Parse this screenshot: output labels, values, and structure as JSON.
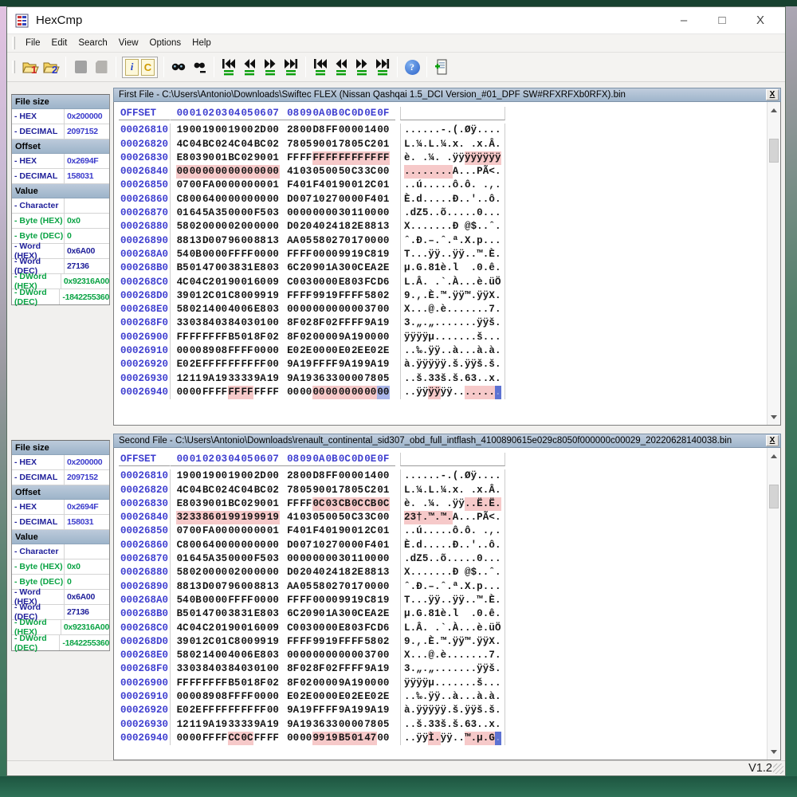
{
  "window": {
    "title": "HexCmp",
    "controls": {
      "minimize": "–",
      "maximize": "□",
      "close": "X"
    }
  },
  "menu": {
    "items": [
      "File",
      "Edit",
      "Search",
      "View",
      "Options",
      "Help"
    ]
  },
  "toolbar": {
    "open_first_label": "1",
    "open_second_label": "2",
    "info_label": "i",
    "compare_label": "C",
    "help_label": "?"
  },
  "status": {
    "version": "V1.2"
  },
  "hex_table": {
    "offset_label": "OFFSET",
    "columns": [
      "00",
      "01",
      "02",
      "03",
      "04",
      "05",
      "06",
      "07",
      "08",
      "09",
      "0A",
      "0B",
      "0C",
      "0D",
      "0E",
      "0F"
    ]
  },
  "colors": {
    "diff_highlight": "#f6c9c9",
    "selection_highlight": "#a9b5e9",
    "cursor_block": "#5d72d2",
    "offset_text": "#3f3fd0",
    "value_green": "#0aa344",
    "value_navy": "#20209a",
    "value_blue": "#3c3ccc",
    "pane_header_bg": "#a9bed4"
  },
  "inspector": {
    "sections": [
      {
        "header": "File size",
        "rows": [
          {
            "label": "- HEX",
            "value": "0x200000",
            "lc": "c-navy",
            "vc": "c-blue"
          },
          {
            "label": "- DECIMAL",
            "value": "2097152",
            "lc": "c-navy",
            "vc": "c-blue"
          }
        ]
      },
      {
        "header": "Offset",
        "rows": [
          {
            "label": "- HEX",
            "value": "0x2694F",
            "lc": "c-navy",
            "vc": "c-blue"
          },
          {
            "label": "- DECIMAL",
            "value": "158031",
            "lc": "c-navy",
            "vc": "c-blue"
          }
        ]
      },
      {
        "header": "Value",
        "rows": [
          {
            "label": "- Character",
            "value": "",
            "lc": "c-navy",
            "vc": "c-navy"
          },
          {
            "label": "- Byte (HEX)",
            "value": "0x0",
            "lc": "c-green",
            "vc": "c-green"
          },
          {
            "label": "- Byte (DEC)",
            "value": "0",
            "lc": "c-green",
            "vc": "c-green"
          },
          {
            "label": "- Word (HEX)",
            "value": "0x6A00",
            "lc": "c-navy",
            "vc": "c-navy"
          },
          {
            "label": "- Word (DEC)",
            "value": "27136",
            "lc": "c-navy",
            "vc": "c-navy"
          },
          {
            "label": "- DWord (HEX)",
            "value": "0x92316A00",
            "lc": "c-green",
            "vc": "c-green"
          },
          {
            "label": "- DWord (DEC)",
            "value": "-1842255360",
            "lc": "c-green",
            "vc": "c-green"
          }
        ]
      }
    ]
  },
  "panes": [
    {
      "title": "First File - C:\\Users\\Antonio\\Downloads\\Swiftec FLEX (Nissan Qashqai 1.5_DCI Version_#01_DPF SW#RFXRFXb0RFX).bin",
      "close_label": "X",
      "rows": [
        {
          "o": "00026810",
          "b": "19 00 19 00 19 00 2D 00 28 00 D8 FF 00 00 14 00",
          "a": "......-.(.Øÿ...."
        },
        {
          "o": "00026820",
          "b": "4C 04 BC 02 4C 04 BC 02 78 05 90 01 78 05 C2 01",
          "a": "L.¼.L.¼.x. .x.Â."
        },
        {
          "o": "00026830",
          "b": "E8 03 90 01 BC 02 90 01 FF FF FF FF FF FF FF FF",
          "a": "è. .¼. .ÿÿÿÿÿÿÿÿ",
          "d": [
            10,
            11,
            12,
            13,
            14,
            15
          ]
        },
        {
          "o": "00026840",
          "b": "00 00 00 00 00 00 00 00 41 03 05 00 50 C3 3C 00",
          "a": "........A...PÃ<.",
          "d": [
            0,
            1,
            2,
            3,
            4,
            5,
            6,
            7
          ]
        },
        {
          "o": "00026850",
          "b": "07 00 FA 00 00 00 00 01 F4 01 F4 01 90 01 2C 01",
          "a": "..ú.....ô.ô. .,."
        },
        {
          "o": "00026860",
          "b": "C8 00 64 00 00 00 00 00 D0 07 10 27 00 00 F4 01",
          "a": "È.d.....Ð..'..ô."
        },
        {
          "o": "00026870",
          "b": "01 64 5A 35 00 00 F5 03 00 00 00 00 30 11 00 00",
          "a": ".dZ5..õ.....0..."
        },
        {
          "o": "00026880",
          "b": "58 02 00 00 02 00 00 00 D0 20 40 24 18 2E 88 13",
          "a": "X.......Ð @$..ˆ."
        },
        {
          "o": "00026890",
          "b": "88 13 D0 07 96 00 88 13 AA 05 58 02 70 17 00 00",
          "a": "ˆ.Ð.–.ˆ.ª.X.p..."
        },
        {
          "o": "000268A0",
          "b": "54 0B 00 00 FF FF 00 00 FF FF 00 00 99 19 C8 19",
          "a": "T...ÿÿ..ÿÿ..™.È."
        },
        {
          "o": "000268B0",
          "b": "B5 01 47 00 38 31 E8 03 6C 20 90 1A 30 0C EA 2E",
          "a": "µ.G.81è.l  .0.ê."
        },
        {
          "o": "000268C0",
          "b": "4C 04 C2 01 90 01 60 09 C0 03 00 00 E8 03 FC D6",
          "a": "L.Â. .`.À...è.üÖ"
        },
        {
          "o": "000268D0",
          "b": "39 01 2C 01 C8 00 99 19 FF FF 99 19 FF FF 58 02",
          "a": "9.,.È.™.ÿÿ™.ÿÿX."
        },
        {
          "o": "000268E0",
          "b": "58 02 14 00 40 06 E8 03 00 00 00 00 00 00 37 00",
          "a": "X...@.è.......7."
        },
        {
          "o": "000268F0",
          "b": "33 03 84 03 84 03 01 00 8F 02 8F 02 FF FF 9A 19",
          "a": "3.„.„.......ÿÿš."
        },
        {
          "o": "00026900",
          "b": "FF FF FF FF B5 01 8F 02 8F 02 00 00 9A 19 00 00",
          "a": "ÿÿÿÿµ.......š..."
        },
        {
          "o": "00026910",
          "b": "00 00 89 08 FF FF 00 00 E0 2E 00 00 E0 2E E0 2E",
          "a": "..‰.ÿÿ..à...à.à."
        },
        {
          "o": "00026920",
          "b": "E0 2E FF FF FF FF FF 00 9A 19 FF FF 9A 19 9A 19",
          "a": "à.ÿÿÿÿÿ.š.ÿÿš.š."
        },
        {
          "o": "00026930",
          "b": "12 11 9A 19 33 33 9A 19 9A 19 36 33 00 00 78 05",
          "a": "..š.33š.š.63..x."
        },
        {
          "o": "00026940",
          "b": "00 00 FF FF FF FF FF FF 00 00 00 00 00 00 00 00",
          "a": "..ÿÿÿÿÿÿ........",
          "d": [
            4,
            5,
            10,
            11,
            12,
            13,
            14
          ],
          "bs": [
            15
          ],
          "cs": [
            15
          ]
        }
      ]
    },
    {
      "title": "Second File - C:\\Users\\Antonio\\Downloads\\renault_continental_sid307_obd_full_intflash_4100890615e029c8050f000000c00029_20220628140038.bin",
      "close_label": "X",
      "rows": [
        {
          "o": "00026810",
          "b": "19 00 19 00 19 00 2D 00 28 00 D8 FF 00 00 14 00",
          "a": "......-.(.Øÿ...."
        },
        {
          "o": "00026820",
          "b": "4C 04 BC 02 4C 04 BC 02 78 05 90 01 78 05 C2 01",
          "a": "L.¼.L.¼.x. .x.Â."
        },
        {
          "o": "00026830",
          "b": "E8 03 90 01 BC 02 90 01 FF FF 0C 03 CB 0C CB 0C",
          "a": "è. .¼. .ÿÿ..Ë.Ë.",
          "d": [
            10,
            11,
            12,
            13,
            14,
            15
          ]
        },
        {
          "o": "00026840",
          "b": "32 33 86 01 99 19 99 19 41 03 05 00 50 C3 3C 00",
          "a": "23†.™.™.A...PÃ<.",
          "d": [
            0,
            1,
            2,
            3,
            4,
            5,
            6,
            7
          ]
        },
        {
          "o": "00026850",
          "b": "07 00 FA 00 00 00 00 01 F4 01 F4 01 90 01 2C 01",
          "a": "..ú.....ô.ô. .,."
        },
        {
          "o": "00026860",
          "b": "C8 00 64 00 00 00 00 00 D0 07 10 27 00 00 F4 01",
          "a": "È.d.....Ð..'..ô."
        },
        {
          "o": "00026870",
          "b": "01 64 5A 35 00 00 F5 03 00 00 00 00 30 11 00 00",
          "a": ".dZ5..õ.....0..."
        },
        {
          "o": "00026880",
          "b": "58 02 00 00 02 00 00 00 D0 20 40 24 18 2E 88 13",
          "a": "X.......Ð @$..ˆ."
        },
        {
          "o": "00026890",
          "b": "88 13 D0 07 96 00 88 13 AA 05 58 02 70 17 00 00",
          "a": "ˆ.Ð.–.ˆ.ª.X.p..."
        },
        {
          "o": "000268A0",
          "b": "54 0B 00 00 FF FF 00 00 FF FF 00 00 99 19 C8 19",
          "a": "T...ÿÿ..ÿÿ..™.È."
        },
        {
          "o": "000268B0",
          "b": "B5 01 47 00 38 31 E8 03 6C 20 90 1A 30 0C EA 2E",
          "a": "µ.G.81è.l  .0.ê."
        },
        {
          "o": "000268C0",
          "b": "4C 04 C2 01 90 01 60 09 C0 03 00 00 E8 03 FC D6",
          "a": "L.Â. .`.À...è.üÖ"
        },
        {
          "o": "000268D0",
          "b": "39 01 2C 01 C8 00 99 19 FF FF 99 19 FF FF 58 02",
          "a": "9.,.È.™.ÿÿ™.ÿÿX."
        },
        {
          "o": "000268E0",
          "b": "58 02 14 00 40 06 E8 03 00 00 00 00 00 00 37 00",
          "a": "X...@.è.......7."
        },
        {
          "o": "000268F0",
          "b": "33 03 84 03 84 03 01 00 8F 02 8F 02 FF FF 9A 19",
          "a": "3.„.„.......ÿÿš."
        },
        {
          "o": "00026900",
          "b": "FF FF FF FF B5 01 8F 02 8F 02 00 00 9A 19 00 00",
          "a": "ÿÿÿÿµ.......š..."
        },
        {
          "o": "00026910",
          "b": "00 00 89 08 FF FF 00 00 E0 2E 00 00 E0 2E E0 2E",
          "a": "..‰.ÿÿ..à...à.à."
        },
        {
          "o": "00026920",
          "b": "E0 2E FF FF FF FF FF 00 9A 19 FF FF 9A 19 9A 19",
          "a": "à.ÿÿÿÿÿ.š.ÿÿš.š."
        },
        {
          "o": "00026930",
          "b": "12 11 9A 19 33 33 9A 19 9A 19 36 33 00 00 78 05",
          "a": "..š.33š.š.63..x."
        },
        {
          "o": "00026940",
          "b": "00 00 FF FF CC 0C FF FF 00 00 99 19 B5 01 47 00",
          "a": "..ÿÿÌ.ÿÿ..™.µ.G.",
          "d": [
            4,
            5,
            10,
            11,
            12,
            13,
            14
          ],
          "cs": [
            15
          ]
        }
      ]
    }
  ]
}
